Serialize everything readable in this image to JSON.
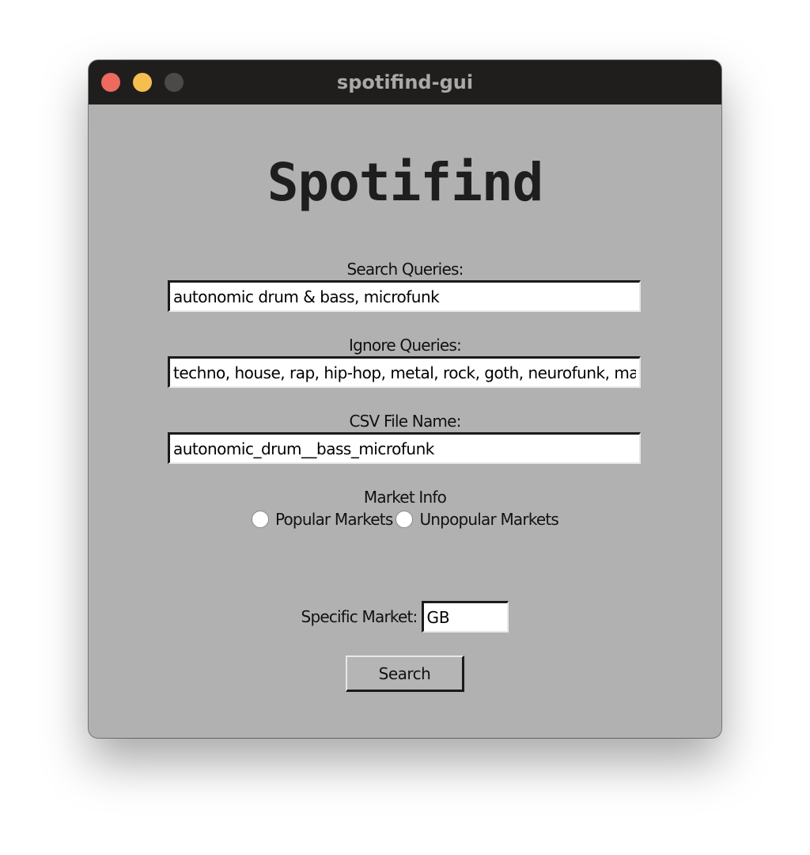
{
  "window": {
    "title": "spotifind-gui"
  },
  "app": {
    "heading": "Spotifind"
  },
  "search_queries": {
    "label": "Search Queries:",
    "value": "autonomic drum & bass, microfunk"
  },
  "ignore_queries": {
    "label": "Ignore Queries:",
    "value": "techno, house, rap, hip-hop, metal, rock, goth, neurofunk, ma"
  },
  "csv_file": {
    "label": "CSV File Name:",
    "value": "autonomic_drum__bass_microfunk"
  },
  "market_info": {
    "label": "Market Info",
    "options": [
      "Popular Markets",
      "Unpopular Markets"
    ]
  },
  "specific_market": {
    "label": "Specific Market:",
    "value": "GB"
  },
  "search_button": {
    "label": "Search"
  },
  "colors": {
    "window_bg": "#b1b1b1",
    "titlebar_bg": "#1f1e1d",
    "close": "#ed6a5e",
    "minimize": "#f5bf4f",
    "maximize": "#4a4a4a"
  }
}
